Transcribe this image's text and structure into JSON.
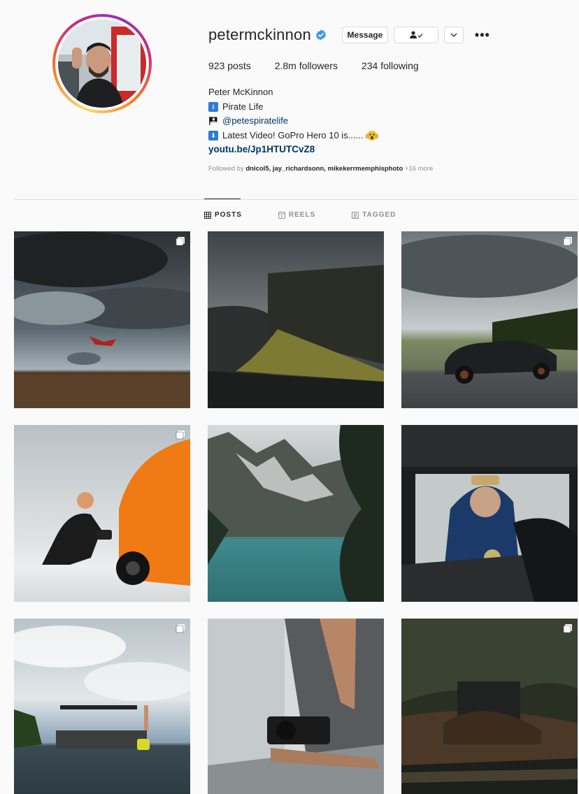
{
  "profile": {
    "username": "petermckinnon",
    "verified": true,
    "buttons": {
      "message": "Message"
    },
    "stats": {
      "posts": "923 posts",
      "followers": "2.8m followers",
      "following": "234 following"
    },
    "bio": {
      "name": "Peter McKinnon",
      "line1": "Pirate Life",
      "line2": "@petespiratelife",
      "line3": "Latest Video! GoPro Hero 10 is......",
      "url": "youtu.be/Jp1HTUTCvZ8"
    },
    "followed_by": {
      "prefix": "Followed by",
      "names": "dnicol5, jay_richardsonn, mikekerrmemphisphoto",
      "suffix": "+16 more"
    }
  },
  "tabs": [
    {
      "label": "POSTS",
      "icon": "grid-icon",
      "active": true
    },
    {
      "label": "REELS",
      "icon": "reels-icon",
      "active": false
    },
    {
      "label": "TAGGED",
      "icon": "tagged-icon",
      "active": false
    }
  ],
  "colors": {
    "link": "#00376b",
    "verified": "#3897f0",
    "muted": "#8e8e8e",
    "text": "#262626"
  }
}
